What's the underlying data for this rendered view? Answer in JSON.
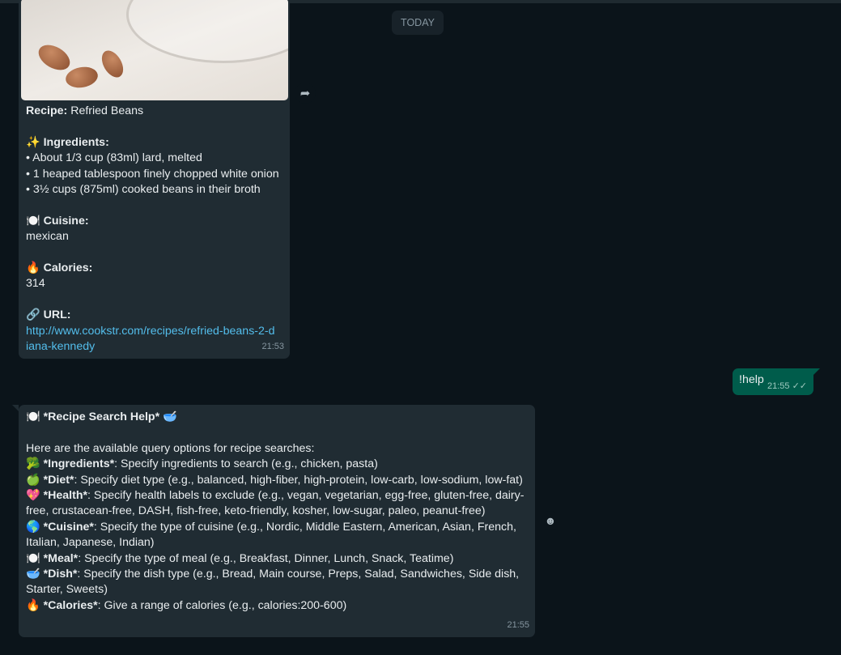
{
  "date_chip": "TODAY",
  "recipe_message": {
    "recipe_label": "Recipe:",
    "recipe_name": " Refried Beans",
    "ingredients_label": "✨ Ingredients:",
    "ingredients": [
      "• About 1/3 cup (83ml) lard, melted",
      "• 1 heaped tablespoon finely chopped white onion",
      "• 3½ cups (875ml) cooked beans in their broth"
    ],
    "cuisine_label": "🍽️ Cuisine:",
    "cuisine": "mexican",
    "calories_label": "🔥 Calories:",
    "calories": "314",
    "url_label": "🔗 URL:",
    "url": "http://www.cookstr.com/recipes/refried-beans-2-diana-kennedy",
    "time": "21:53"
  },
  "outgoing_message": {
    "text": "!help",
    "time": "21:55",
    "status_icon": "double-check-icon"
  },
  "help_message": {
    "title": "🍽️ *Recipe Search Help* 🥣",
    "intro": "Here are the available query options for recipe searches:",
    "options": [
      {
        "label": "🥦 *Ingredients*",
        "text": ": Specify ingredients to search (e.g., chicken, pasta)"
      },
      {
        "label": "🍏 *Diet*",
        "text": ": Specify diet type (e.g., balanced, high-fiber, high-protein, low-carb, low-sodium, low-fat)"
      },
      {
        "label": "💖 *Health*",
        "text": ": Specify health labels to exclude (e.g., vegan, vegetarian, egg-free, gluten-free, dairy-free, crustacean-free, DASH, fish-free, keto-friendly, kosher, low-sugar, paleo, peanut-free)"
      },
      {
        "label": "🌎 *Cuisine*",
        "text": ": Specify the type of cuisine (e.g., Nordic, Middle Eastern, American, Asian, French, Italian, Japanese, Indian)"
      },
      {
        "label": "🍽️ *Meal*",
        "text": ": Specify the type of meal (e.g., Breakfast, Dinner, Lunch, Snack, Teatime)"
      },
      {
        "label": "🥣 *Dish*",
        "text": ": Specify the dish type (e.g., Bread, Main course, Preps, Salad, Sandwiches, Side dish, Starter, Sweets)"
      },
      {
        "label": "🔥 *Calories*",
        "text": ": Give a range of calories (e.g., calories:200-600)"
      }
    ],
    "time": "21:55"
  }
}
